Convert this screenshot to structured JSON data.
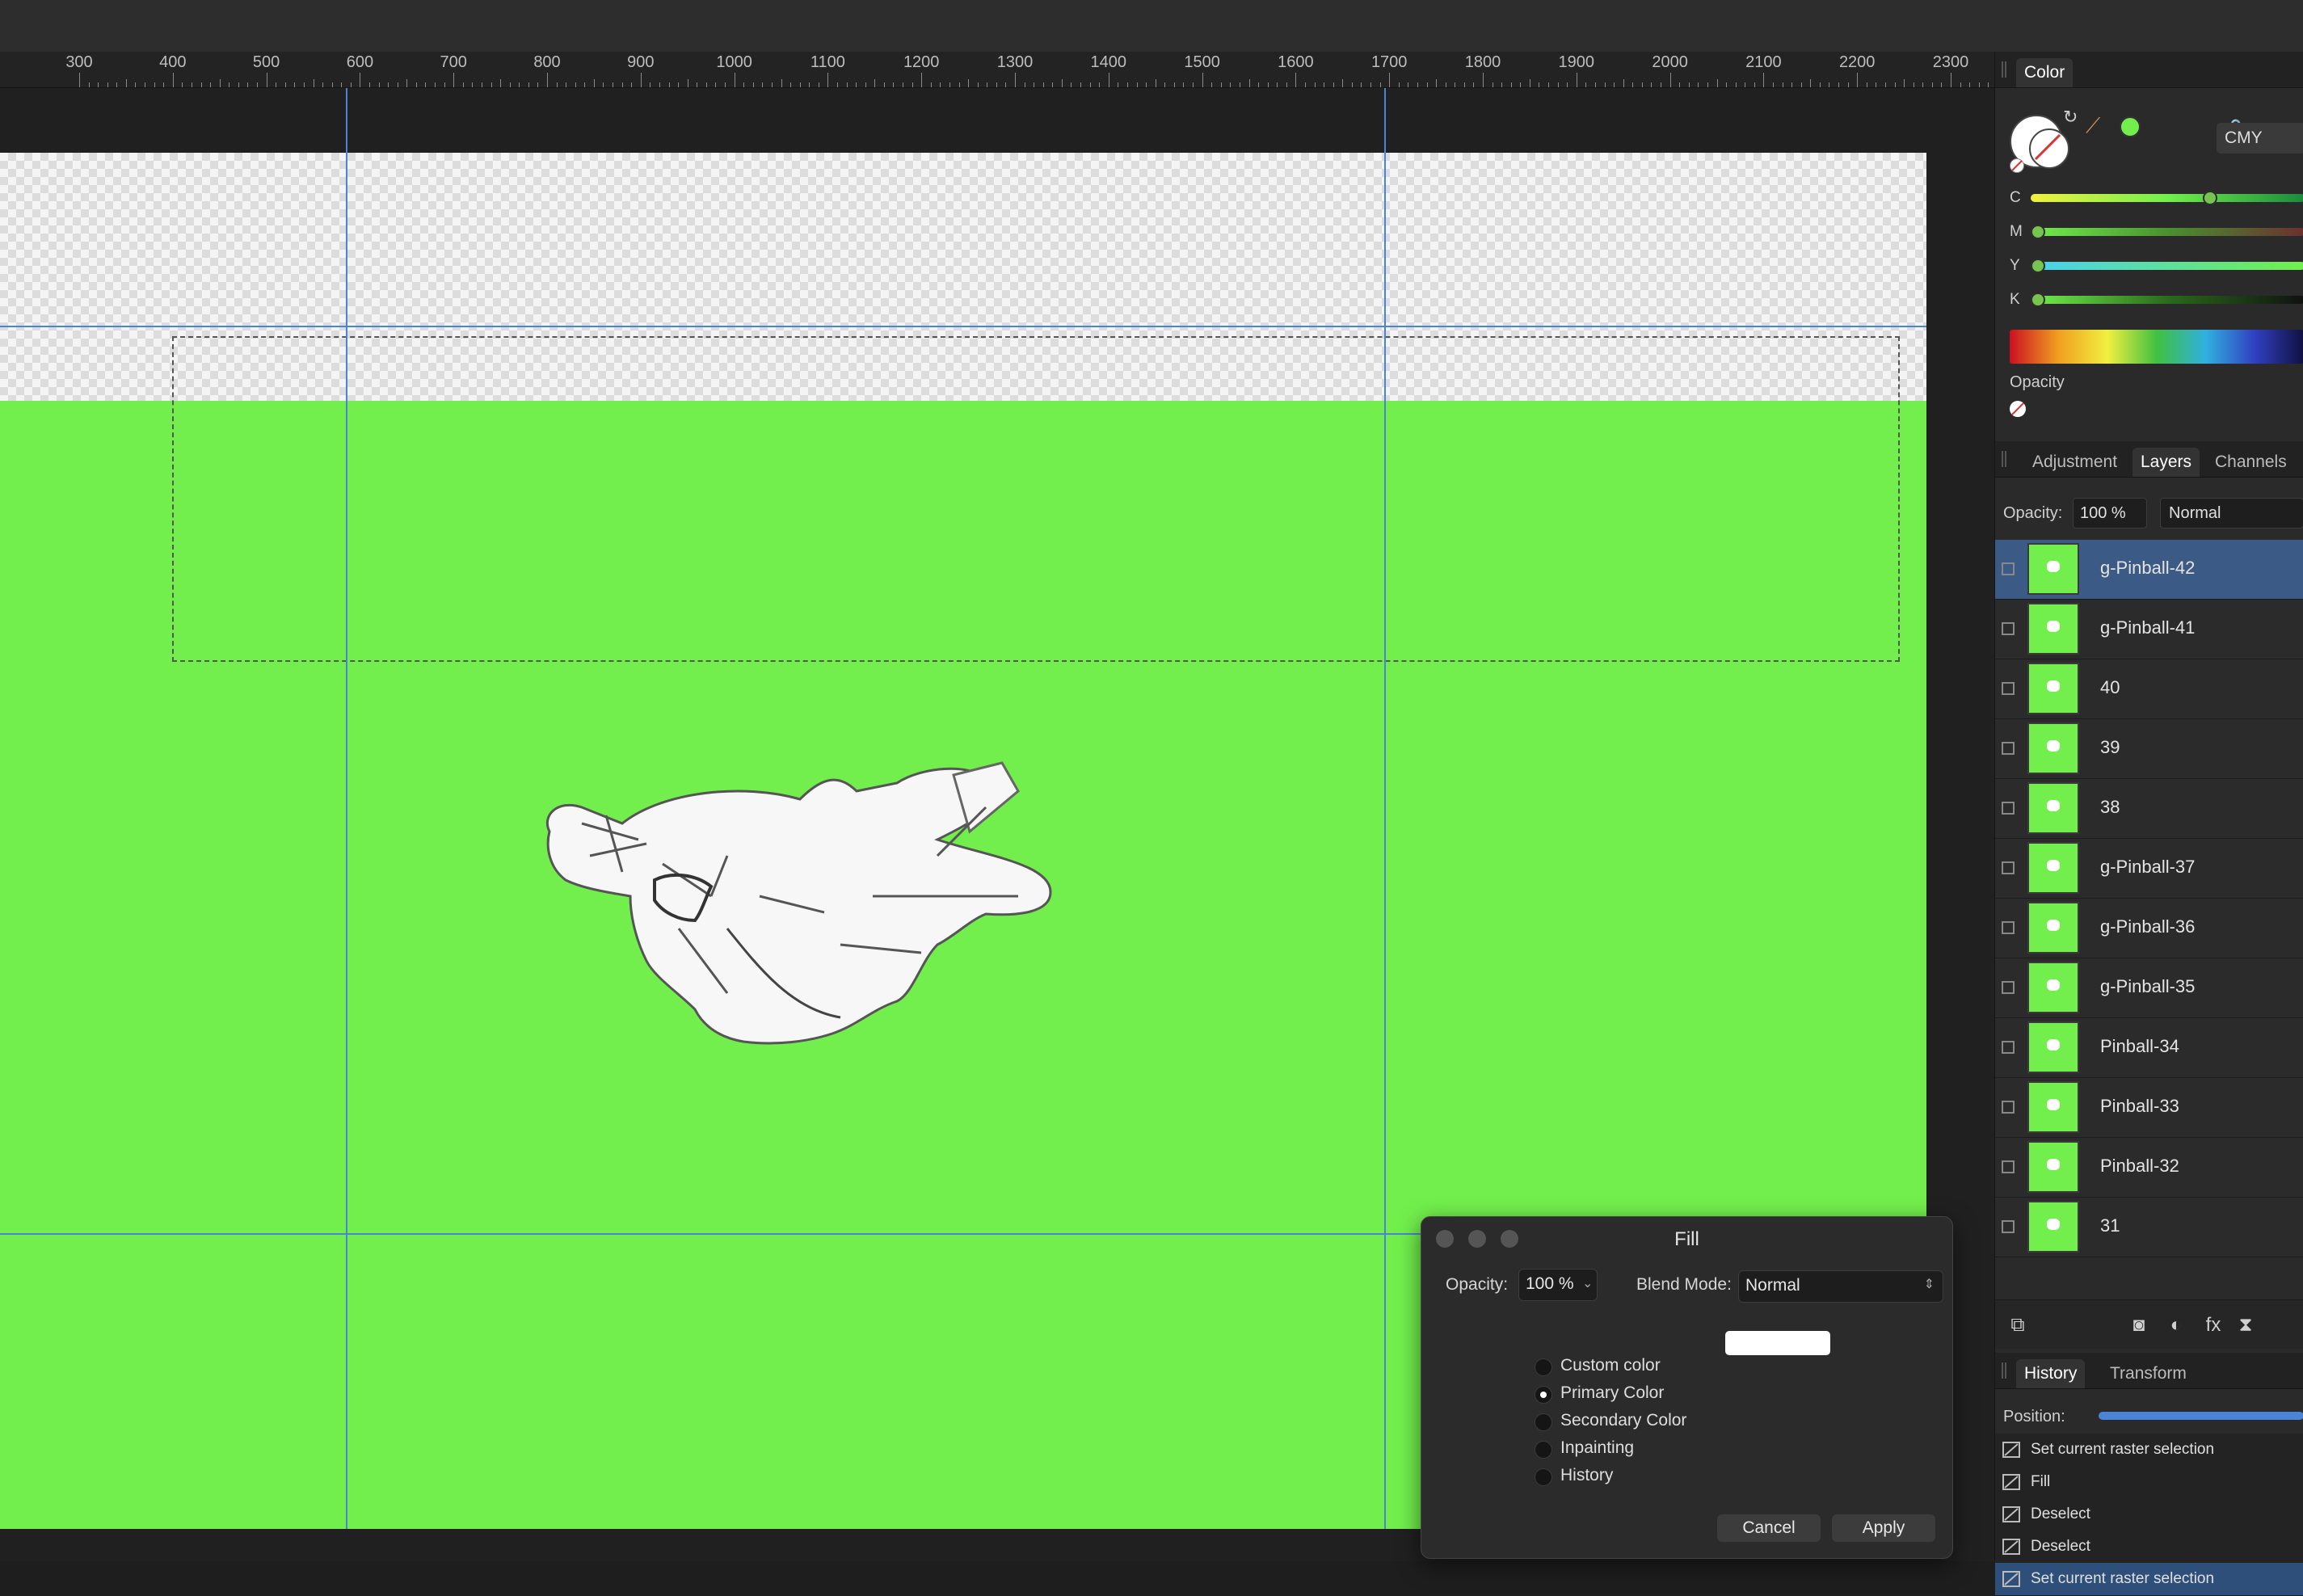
{
  "ruler": {
    "labels": [
      "300",
      "400",
      "500",
      "600",
      "700",
      "800",
      "900",
      "1000",
      "1100",
      "1200",
      "1300",
      "1400",
      "1500",
      "1600",
      "1700",
      "1800",
      "1900",
      "2000",
      "2100",
      "2200",
      "2300"
    ]
  },
  "fill_dialog": {
    "title": "Fill",
    "opacity_label": "Opacity:",
    "opacity_value": "100 %",
    "blend_label": "Blend Mode:",
    "blend_value": "Normal",
    "options": [
      {
        "label": "Custom color",
        "selected": false
      },
      {
        "label": "Primary Color",
        "selected": true
      },
      {
        "label": "Secondary Color",
        "selected": false
      },
      {
        "label": "Inpainting",
        "selected": false
      },
      {
        "label": "History",
        "selected": false
      }
    ],
    "swatch_color": "#ffffff",
    "cancel_label": "Cancel",
    "apply_label": "Apply"
  },
  "color_panel": {
    "tab": "Color",
    "mode": "CMY",
    "sliders": [
      {
        "label": "C",
        "value": 0.38
      },
      {
        "label": "M",
        "value": 0.0
      },
      {
        "label": "Y",
        "value": 0.0
      },
      {
        "label": "K",
        "value": 0.0
      }
    ],
    "opacity_label": "Opacity",
    "primary_swatch_color": "#72ef4c"
  },
  "layers_panel": {
    "tabs": [
      "Adjustment",
      "Layers",
      "Channels"
    ],
    "active_tab": "Layers",
    "opacity_label": "Opacity:",
    "opacity_value": "100 %",
    "blend_value": "Normal",
    "layers": [
      {
        "name": "g-Pinball-42",
        "selected": true
      },
      {
        "name": "g-Pinball-41",
        "selected": false
      },
      {
        "name": "40",
        "selected": false
      },
      {
        "name": "39",
        "selected": false
      },
      {
        "name": "38",
        "selected": false
      },
      {
        "name": "g-Pinball-37",
        "selected": false
      },
      {
        "name": "g-Pinball-36",
        "selected": false
      },
      {
        "name": "g-Pinball-35",
        "selected": false
      },
      {
        "name": "Pinball-34",
        "selected": false
      },
      {
        "name": "Pinball-33",
        "selected": false
      },
      {
        "name": "Pinball-32",
        "selected": false
      },
      {
        "name": "31",
        "selected": false
      }
    ]
  },
  "history_panel": {
    "tabs": [
      "History",
      "Transform"
    ],
    "active_tab": "History",
    "position_label": "Position:",
    "entries": [
      {
        "label": "Set current raster selection",
        "selected": false
      },
      {
        "label": "Fill",
        "selected": false
      },
      {
        "label": "Deselect",
        "selected": false
      },
      {
        "label": "Deselect",
        "selected": false
      },
      {
        "label": "Set current raster selection",
        "selected": true
      }
    ]
  },
  "colors": {
    "canvas_fill": "#72ef4c",
    "guide": "#4a84d6",
    "selection_highlight": "#3b5a86"
  }
}
